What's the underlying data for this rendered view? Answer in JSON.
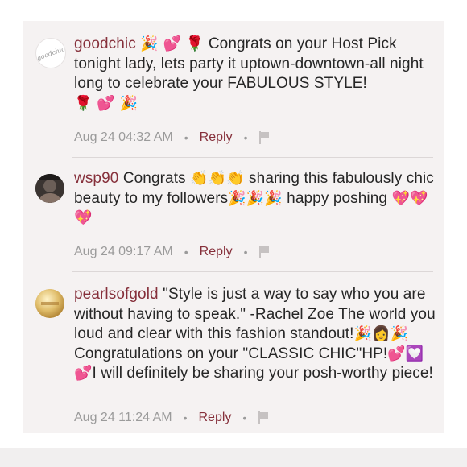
{
  "comments": [
    {
      "username": "goodchic",
      "avatar_icon": "goodchic-logo-avatar",
      "lead_emojis": "🎉 💕 🌹",
      "text": "Congrats on your Host Pick tonight lady, lets party it uptown-downtown-all night long to celebrate your FABULOUS STYLE!",
      "trail_emojis": "🌹 💕 🎉",
      "timestamp": "Aug 24 04:32 AM",
      "reply_label": "Reply"
    },
    {
      "username": "wsp90",
      "avatar_icon": "user-photo-avatar",
      "text_part1": "Congrats",
      "emojis1": "👏👏👏",
      "text_part2": "sharing this fabulously chic beauty to my followers",
      "emojis2": "🎉🎉🎉",
      "text_part3": "happy poshing",
      "emojis3": "💖💖💖",
      "timestamp": "Aug 24 09:17 AM",
      "reply_label": "Reply"
    },
    {
      "username": "pearlsofgold",
      "avatar_icon": "pearls-gold-avatar",
      "text_part1": "\"Style is just a way to say who you are without having to speak.\" -Rachel Zoe The world you loud and clear with this fashion standout!",
      "emojis1": "🎉👩🎉",
      "text_part2": "Congratulations on your \"CLASSIC CHIC\"HP!",
      "emojis2": "💕💟💕",
      "text_part3": "I will definitely be sharing your posh-worthy piece!",
      "timestamp": "Aug 24 11:24 AM",
      "reply_label": "Reply"
    }
  ],
  "separator_dot": "•",
  "colors": {
    "username": "#86303b",
    "text": "#262626",
    "meta": "#9b9b9b",
    "panel": "#f5f2f2"
  }
}
